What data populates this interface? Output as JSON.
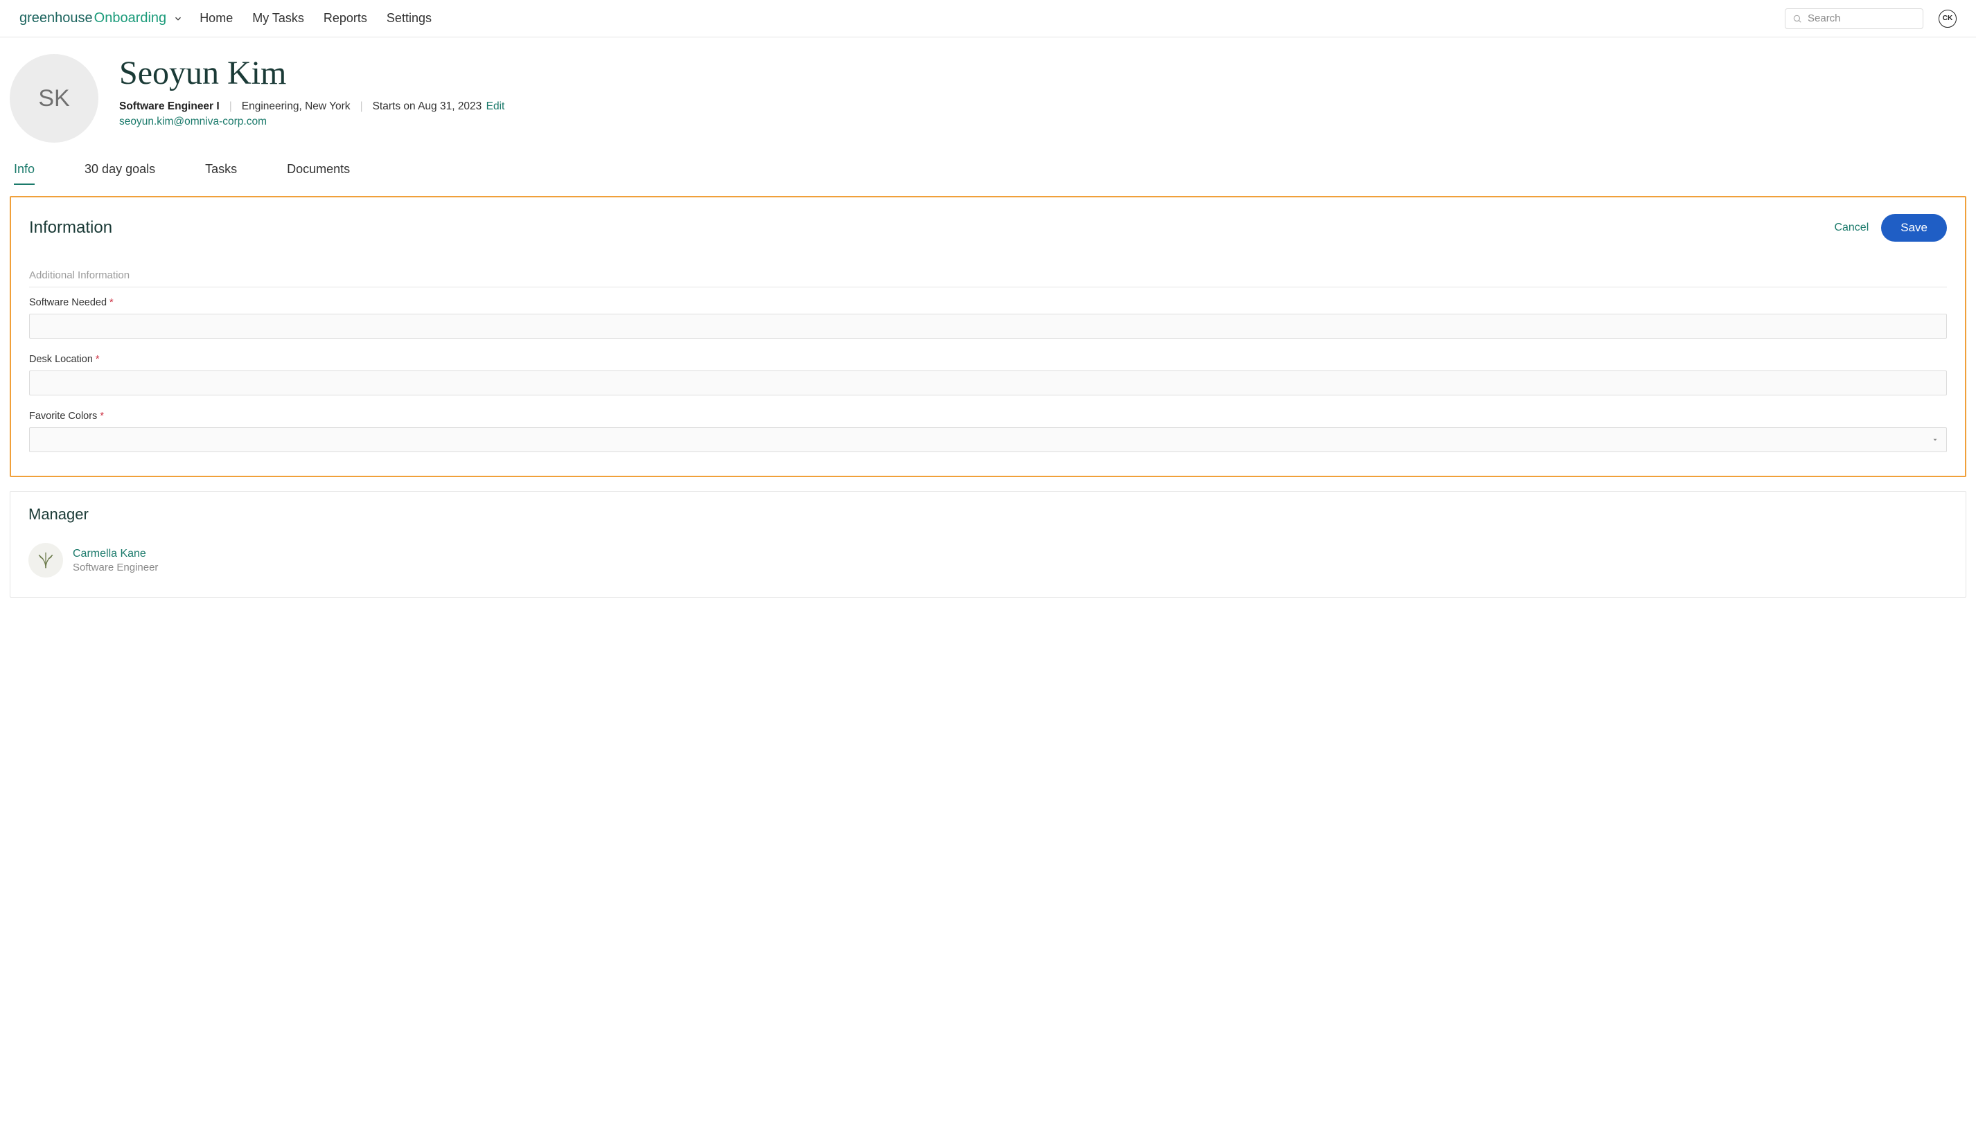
{
  "brand": {
    "greenhouse": "greenhouse",
    "onboarding": "Onboarding"
  },
  "nav": {
    "home": "Home",
    "my_tasks": "My Tasks",
    "reports": "Reports",
    "settings": "Settings"
  },
  "search": {
    "placeholder": "Search"
  },
  "user_badge": "CK",
  "profile": {
    "initials": "SK",
    "name": "Seoyun Kim",
    "job_title": "Software Engineer I",
    "department_location": "Engineering, New York",
    "start_text": "Starts on Aug 31, 2023",
    "edit_label": "Edit",
    "email": "seoyun.kim@omniva-corp.com"
  },
  "tabs": {
    "info": "Info",
    "goals": "30 day goals",
    "tasks": "Tasks",
    "documents": "Documents"
  },
  "info_panel": {
    "title": "Information",
    "cancel": "Cancel",
    "save": "Save",
    "section_label": "Additional Information",
    "fields": {
      "software_needed": {
        "label": "Software Needed",
        "value": ""
      },
      "desk_location": {
        "label": "Desk Location",
        "value": ""
      },
      "favorite_colors": {
        "label": "Favorite Colors",
        "value": ""
      }
    },
    "required_marker": "*"
  },
  "manager_panel": {
    "title": "Manager",
    "name": "Carmella Kane",
    "role": "Software Engineer"
  }
}
